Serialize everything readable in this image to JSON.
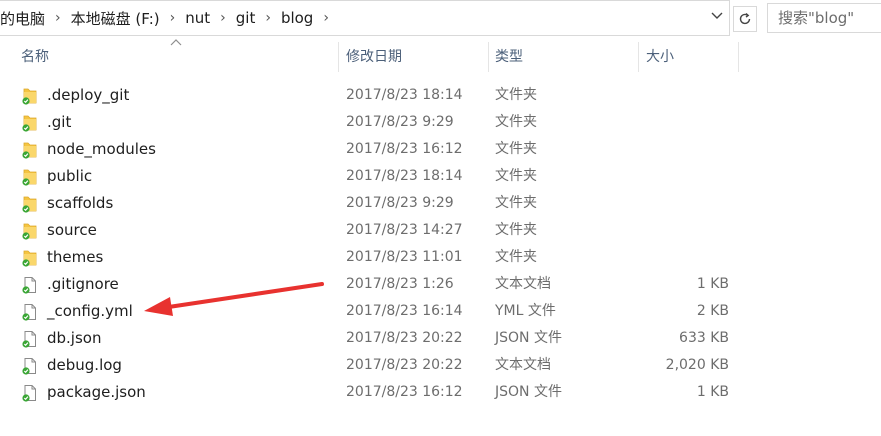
{
  "breadcrumb": [
    "的电脑",
    "本地磁盘 (F:)",
    "nut",
    "git",
    "blog"
  ],
  "search": {
    "placeholder": "搜索\"blog\""
  },
  "columns": {
    "name": "名称",
    "date": "修改日期",
    "type": "类型",
    "size": "大小"
  },
  "files": [
    {
      "name": ".deploy_git",
      "date": "2017/8/23 18:14",
      "type": "文件夹",
      "size": "",
      "icon": "folder-synced-icon"
    },
    {
      "name": ".git",
      "date": "2017/8/23 9:29",
      "type": "文件夹",
      "size": "",
      "icon": "folder-synced-icon"
    },
    {
      "name": "node_modules",
      "date": "2017/8/23 16:12",
      "type": "文件夹",
      "size": "",
      "icon": "folder-synced-icon"
    },
    {
      "name": "public",
      "date": "2017/8/23 18:14",
      "type": "文件夹",
      "size": "",
      "icon": "folder-synced-icon"
    },
    {
      "name": "scaffolds",
      "date": "2017/8/23 9:29",
      "type": "文件夹",
      "size": "",
      "icon": "folder-synced-icon"
    },
    {
      "name": "source",
      "date": "2017/8/23 14:27",
      "type": "文件夹",
      "size": "",
      "icon": "folder-synced-icon"
    },
    {
      "name": "themes",
      "date": "2017/8/23 11:01",
      "type": "文件夹",
      "size": "",
      "icon": "folder-synced-icon"
    },
    {
      "name": ".gitignore",
      "date": "2017/8/23 1:26",
      "type": "文本文档",
      "size": "1 KB",
      "icon": "file-synced-icon"
    },
    {
      "name": "_config.yml",
      "date": "2017/8/23 16:14",
      "type": "YML 文件",
      "size": "2 KB",
      "icon": "file-synced-icon"
    },
    {
      "name": "db.json",
      "date": "2017/8/23 20:22",
      "type": "JSON 文件",
      "size": "633 KB",
      "icon": "file-synced-icon"
    },
    {
      "name": "debug.log",
      "date": "2017/8/23 20:22",
      "type": "文本文档",
      "size": "2,020 KB",
      "icon": "file-synced-icon"
    },
    {
      "name": "package.json",
      "date": "2017/8/23 16:12",
      "type": "JSON 文件",
      "size": "1 KB",
      "icon": "file-synced-icon"
    }
  ],
  "colors": {
    "arrow": "#e8322f",
    "folder": "#f5c542",
    "sync_check": "#3aa635",
    "header_text": "#4c607a"
  }
}
